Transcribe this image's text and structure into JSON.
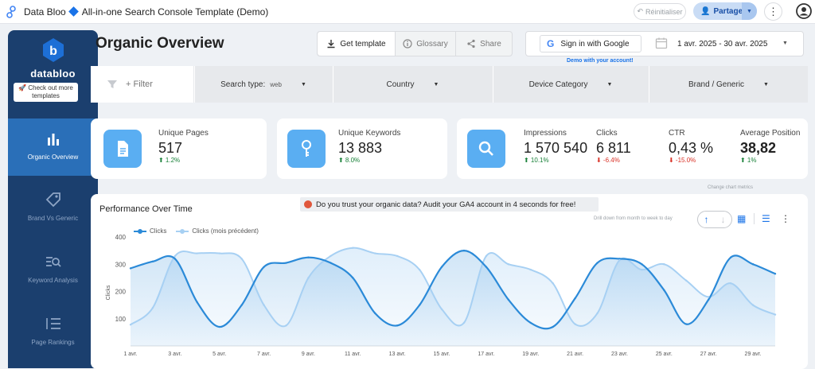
{
  "topbar": {
    "app_title": "Data Bloo",
    "report_title": "All-in-one Search Console Template (Demo)",
    "reset_label": "Réinitialiser",
    "share_label": "Partager"
  },
  "sidebar": {
    "logo_text": "databloo",
    "more_templates": "🚀 Check out more templates",
    "items": [
      {
        "label": "Organic Overview",
        "icon": "bar-chart-icon"
      },
      {
        "label": "Brand Vs Generic",
        "icon": "tag-icon"
      },
      {
        "label": "Keyword Analysis",
        "icon": "keyword-search-icon"
      },
      {
        "label": "Page Rankings",
        "icon": "ranking-list-icon"
      }
    ]
  },
  "header": {
    "title": "Organic Overview",
    "get_template": "Get template",
    "glossary": "Glossary",
    "share": "Share",
    "sign_in": "Sign in with Google",
    "demo_note": "Demo with your account!",
    "date_range": "1 avr. 2025 - 30 avr. 2025"
  },
  "filters": {
    "filter_label": "+ Filter",
    "search_type_label": "Search type:",
    "search_type_value": "web",
    "country": "Country",
    "device": "Device Category",
    "brand": "Brand / Generic"
  },
  "kpis": {
    "unique_pages": {
      "label": "Unique Pages",
      "value": "517",
      "delta": "⬆ 1.2%"
    },
    "unique_keywords": {
      "label": "Unique Keywords",
      "value": "13 883",
      "delta": "⬆ 8.0%"
    },
    "impressions": {
      "label": "Impressions",
      "value": "1 570 540",
      "delta": "⬆ 10.1%"
    },
    "clicks": {
      "label": "Clicks",
      "value": "6 811",
      "delta": "⬇ -6.4%"
    },
    "ctr": {
      "label": "CTR",
      "value": "0,43 %",
      "delta": "⬇ -15.0%"
    },
    "avg_position": {
      "label": "Average Position",
      "value": "38,82",
      "delta": "⬆ 1%"
    }
  },
  "chart": {
    "title": "Performance Over Time",
    "banner": "Do you trust your organic data? Audit your GA4 account in 4 seconds for free!",
    "metric_note": "Change chart metrics",
    "drill_note": "Drill down from month to week to day"
  },
  "colors": {
    "primary": "#2b8ad8",
    "previous": "#a7d0f3",
    "sidebar": "#1b3f6e",
    "accent": "#5aaef2"
  },
  "chart_data": {
    "type": "area",
    "x": [
      "1 avr.",
      "2 avr.",
      "3 avr.",
      "4 avr.",
      "5 avr.",
      "6 avr.",
      "7 avr.",
      "8 avr.",
      "9 avr.",
      "10 avr.",
      "11 avr.",
      "12 avr.",
      "13 avr.",
      "14 avr.",
      "15 avr.",
      "16 avr.",
      "17 avr.",
      "18 avr.",
      "19 avr.",
      "20 avr.",
      "21 avr.",
      "22 avr.",
      "23 avr.",
      "24 avr.",
      "25 avr.",
      "26 avr.",
      "27 avr.",
      "28 avr.",
      "29 avr.",
      "30 avr."
    ],
    "tick_labels": [
      "1 avr.",
      "3 avr.",
      "5 avr.",
      "7 avr.",
      "9 avr.",
      "11 avr.",
      "13 avr.",
      "15 avr.",
      "17 avr.",
      "19 avr.",
      "21 avr.",
      "23 avr.",
      "25 avr.",
      "27 avr.",
      "29 avr."
    ],
    "series": [
      {
        "name": "Clicks",
        "values": [
          285,
          310,
          320,
          160,
          70,
          150,
          290,
          305,
          325,
          305,
          250,
          120,
          75,
          150,
          290,
          350,
          290,
          170,
          85,
          70,
          175,
          305,
          320,
          300,
          205,
          80,
          170,
          325,
          300,
          265
        ]
      },
      {
        "name": "Clicks (mois précédent)",
        "values": [
          78,
          140,
          330,
          340,
          340,
          320,
          150,
          75,
          250,
          330,
          360,
          340,
          330,
          280,
          135,
          85,
          330,
          300,
          280,
          230,
          80,
          120,
          315,
          280,
          300,
          240,
          180,
          230,
          150,
          115
        ]
      }
    ],
    "yticks": [
      100,
      200,
      300,
      400
    ],
    "ylim": [
      0,
      400
    ],
    "ylabel": "Clicks",
    "legend": "top-left",
    "grid": false
  }
}
